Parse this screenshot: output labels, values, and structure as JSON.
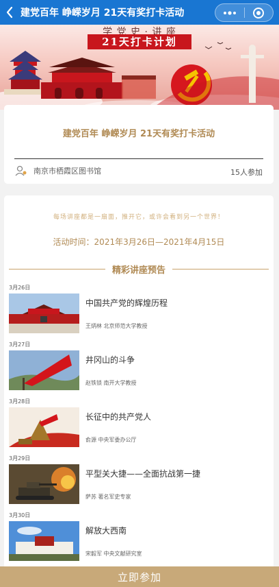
{
  "navbar": {
    "title": "建党百年 峥嵘岁月 21天有奖打卡活动",
    "color": "#1976d2"
  },
  "banner": {
    "top_text": "学 党 史 · 讲 座",
    "title": "21天打卡计划"
  },
  "info": {
    "title": "建党百年 峥嵘岁月 21天有奖打卡活动",
    "organizer": "南京市栖霞区图书馆",
    "participants": "15人参加"
  },
  "main": {
    "motto": "每场讲座都是一扇面，推开它，或许会看到另一个世界！",
    "event_time": "活动时间：2021年3月26日—2021年4月15日",
    "section_title": "精彩讲座预告",
    "lectures": [
      {
        "date": "3月26日",
        "title": "中国共产党的辉煌历程",
        "speaker": "王炳林 北京师范大学教授",
        "thumb": "tiananmen"
      },
      {
        "date": "3月27日",
        "title": "井冈山的斗争",
        "speaker": "赵铁锁 南开大学教授",
        "thumb": "red-flag"
      },
      {
        "date": "3月28日",
        "title": "长征中的共产党人",
        "speaker": "俞源 中央军委办公厅",
        "thumb": "long-march-statue"
      },
      {
        "date": "3月29日",
        "title": "平型关大捷——全面抗战第一捷",
        "speaker": "萨苏 著名军史专家",
        "thumb": "tank-battle"
      },
      {
        "date": "3月30日",
        "title": "解放大西南",
        "speaker": "宋毅军 中央文献研究室",
        "thumb": "potala-palace"
      }
    ]
  },
  "join_button": {
    "label": "立即参加",
    "color": "#c8a979"
  }
}
